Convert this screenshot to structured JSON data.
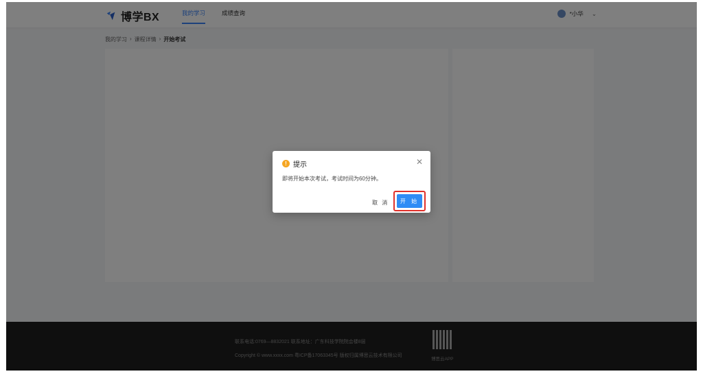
{
  "header": {
    "logo_text": "博学BX",
    "nav": [
      {
        "label": "我的学习",
        "active": true
      },
      {
        "label": "成绩查询",
        "active": false
      }
    ],
    "user_name": "*小华"
  },
  "breadcrumb": {
    "items": [
      "我的学习",
      "课程详情",
      "开始考试"
    ],
    "separator": "›"
  },
  "footer": {
    "line1": "联系电话:0769—8832021    联系地址：广东科技学院院会楼8层",
    "line2": "Copyright © www.xxxx.com 粤ICP备17063345号    版权归属博思云技术有限公司",
    "qr_label": "博思云APP"
  },
  "dialog": {
    "title": "提示",
    "message": "即将开始本次考试，考试时间为60分钟。",
    "cancel_label": "取 消",
    "confirm_label": "开 始",
    "icon": "warning-icon",
    "accent_color": "#2f8cf5",
    "highlight_color": "#e0302a"
  }
}
